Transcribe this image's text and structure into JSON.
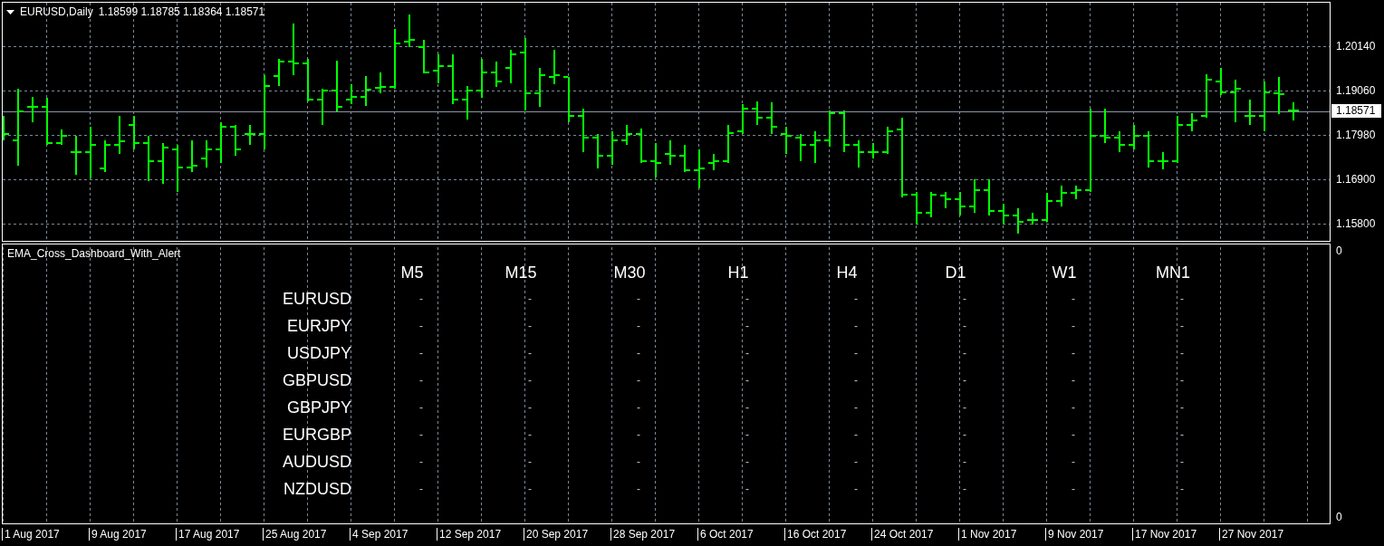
{
  "chart": {
    "title": "EURUSD,Daily",
    "quote": "1.18599 1.18785 1.18364 1.18571",
    "price_labels": [
      "1.20140",
      "1.19060",
      "1.17980",
      "1.16900",
      "1.15800"
    ],
    "current_price": "1.18571"
  },
  "indicator": {
    "title": "EMA_Cross_Dashboard_With_Alert",
    "scale_labels": [
      "0",
      "0"
    ],
    "timeframes": [
      "M5",
      "M15",
      "M30",
      "H1",
      "H4",
      "D1",
      "W1",
      "MN1"
    ],
    "rows": [
      {
        "symbol": "EURUSD",
        "signals": [
          "-",
          "-",
          "-",
          "-",
          "-",
          "-",
          "-",
          "-"
        ]
      },
      {
        "symbol": "EURJPY",
        "signals": [
          "-",
          "-",
          "-",
          "-",
          "-",
          "-",
          "-",
          "-"
        ]
      },
      {
        "symbol": "USDJPY",
        "signals": [
          "-",
          "-",
          "-",
          "-",
          "-",
          "-",
          "-",
          "-"
        ]
      },
      {
        "symbol": "GBPUSD",
        "signals": [
          "-",
          "-",
          "-",
          "-",
          "-",
          "-",
          "-",
          "-"
        ]
      },
      {
        "symbol": "GBPJPY",
        "signals": [
          "-",
          "-",
          "-",
          "-",
          "-",
          "-",
          "-",
          "-"
        ]
      },
      {
        "symbol": "EURGBP",
        "signals": [
          "-",
          "-",
          "-",
          "-",
          "-",
          "-",
          "-",
          "-"
        ]
      },
      {
        "symbol": "AUDUSD",
        "signals": [
          "-",
          "-",
          "-",
          "-",
          "-",
          "-",
          "-",
          "-"
        ]
      },
      {
        "symbol": "NZDUSD",
        "signals": [
          "-",
          "-",
          "-",
          "-",
          "-",
          "-",
          "-",
          "-"
        ]
      }
    ]
  },
  "time_axis": [
    "1 Aug 2017",
    "9 Aug 2017",
    "17 Aug 2017",
    "25 Aug 2017",
    "4 Sep 2017",
    "12 Sep 2017",
    "20 Sep 2017",
    "28 Sep 2017",
    "6 Oct 2017",
    "16 Oct 2017",
    "24 Oct 2017",
    "1 Nov 2017",
    "9 Nov 2017",
    "17 Nov 2017",
    "27 Nov 2017"
  ]
}
